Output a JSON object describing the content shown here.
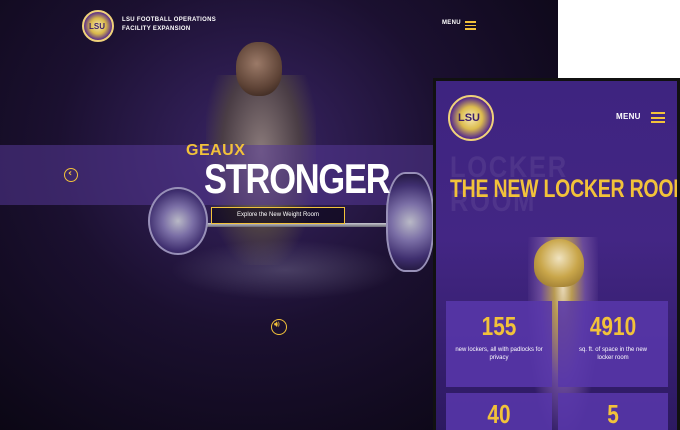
{
  "desktop": {
    "logo_text": "LSU",
    "site_title_line1": "LSU FOOTBALL OPERATIONS",
    "site_title_line2": "FACILITY EXPANSION",
    "menu_label": "MENU",
    "hero": {
      "kicker": "GEAUX",
      "headline": "STRONGER",
      "cta_label": "Explore the New Weight Room",
      "prev_icon": "chevron-left-icon",
      "audio_icon": "speaker-icon"
    }
  },
  "mobile": {
    "logo_text": "LSU",
    "menu_label": "MENU",
    "ghost_text": "LOCKER ROOM",
    "headline": "THE NEW LOCKER ROOM",
    "stats": [
      {
        "value": "155",
        "description": "new lockers, all with padlocks for privacy"
      },
      {
        "value": "4910",
        "description": "sq. ft. of space in the new locker room"
      },
      {
        "value": "40",
        "description": ""
      },
      {
        "value": "5",
        "description": ""
      }
    ]
  },
  "colors": {
    "accent_gold": "#f2c23a",
    "brand_purple": "#432684",
    "dark_bg": "#08050f"
  }
}
